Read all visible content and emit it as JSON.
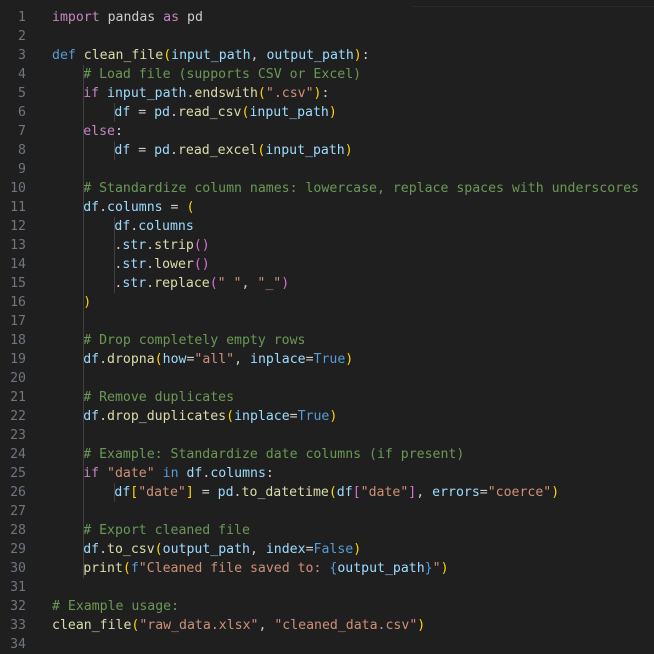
{
  "editor": {
    "line_numbers": [
      "1",
      "2",
      "3",
      "4",
      "5",
      "6",
      "7",
      "8",
      "9",
      "10",
      "11",
      "12",
      "13",
      "14",
      "15",
      "16",
      "17",
      "18",
      "19",
      "20",
      "21",
      "22",
      "23",
      "24",
      "25",
      "26",
      "27",
      "28",
      "29",
      "30",
      "31",
      "32",
      "33",
      "34"
    ],
    "lines": [
      [
        [
          "kw",
          "import"
        ],
        [
          "pun",
          " pandas "
        ],
        [
          "kw",
          "as"
        ],
        [
          "pun",
          " pd"
        ]
      ],
      [],
      [
        [
          "kwb",
          "def"
        ],
        [
          "pun",
          " "
        ],
        [
          "fn",
          "clean_file"
        ],
        [
          "p1",
          "("
        ],
        [
          "var",
          "input_path"
        ],
        [
          "pun",
          ", "
        ],
        [
          "var",
          "output_path"
        ],
        [
          "p1",
          ")"
        ],
        [
          "pun",
          ":"
        ]
      ],
      [
        [
          "com",
          "# Load file (supports CSV or Excel)"
        ]
      ],
      [
        [
          "kw",
          "if"
        ],
        [
          "pun",
          " "
        ],
        [
          "var",
          "input_path"
        ],
        [
          "pun",
          "."
        ],
        [
          "fn",
          "endswith"
        ],
        [
          "p1",
          "("
        ],
        [
          "str",
          "\".csv\""
        ],
        [
          "p1",
          ")"
        ],
        [
          "pun",
          ":"
        ]
      ],
      [
        [
          "var",
          "df"
        ],
        [
          "pun",
          " = "
        ],
        [
          "var",
          "pd"
        ],
        [
          "pun",
          "."
        ],
        [
          "fn",
          "read_csv"
        ],
        [
          "p1",
          "("
        ],
        [
          "var",
          "input_path"
        ],
        [
          "p1",
          ")"
        ]
      ],
      [
        [
          "kw",
          "else"
        ],
        [
          "pun",
          ":"
        ]
      ],
      [
        [
          "var",
          "df"
        ],
        [
          "pun",
          " = "
        ],
        [
          "var",
          "pd"
        ],
        [
          "pun",
          "."
        ],
        [
          "fn",
          "read_excel"
        ],
        [
          "p1",
          "("
        ],
        [
          "var",
          "input_path"
        ],
        [
          "p1",
          ")"
        ]
      ],
      [],
      [
        [
          "com",
          "# Standardize column names: lowercase, replace spaces with underscores"
        ]
      ],
      [
        [
          "var",
          "df"
        ],
        [
          "pun",
          "."
        ],
        [
          "var",
          "columns"
        ],
        [
          "pun",
          " = "
        ],
        [
          "p1",
          "("
        ]
      ],
      [
        [
          "var",
          "df"
        ],
        [
          "pun",
          "."
        ],
        [
          "var",
          "columns"
        ]
      ],
      [
        [
          "pun",
          "."
        ],
        [
          "var",
          "str"
        ],
        [
          "pun",
          "."
        ],
        [
          "fn",
          "strip"
        ],
        [
          "p2",
          "()"
        ]
      ],
      [
        [
          "pun",
          "."
        ],
        [
          "var",
          "str"
        ],
        [
          "pun",
          "."
        ],
        [
          "fn",
          "lower"
        ],
        [
          "p2",
          "()"
        ]
      ],
      [
        [
          "pun",
          "."
        ],
        [
          "var",
          "str"
        ],
        [
          "pun",
          "."
        ],
        [
          "fn",
          "replace"
        ],
        [
          "p2",
          "("
        ],
        [
          "str",
          "\" \""
        ],
        [
          "pun",
          ", "
        ],
        [
          "str",
          "\"_\""
        ],
        [
          "p2",
          ")"
        ]
      ],
      [
        [
          "p1",
          ")"
        ]
      ],
      [],
      [
        [
          "com",
          "# Drop completely empty rows"
        ]
      ],
      [
        [
          "var",
          "df"
        ],
        [
          "pun",
          "."
        ],
        [
          "fn",
          "dropna"
        ],
        [
          "p1",
          "("
        ],
        [
          "var",
          "how"
        ],
        [
          "pun",
          "="
        ],
        [
          "str",
          "\"all\""
        ],
        [
          "pun",
          ", "
        ],
        [
          "var",
          "inplace"
        ],
        [
          "pun",
          "="
        ],
        [
          "kwb",
          "True"
        ],
        [
          "p1",
          ")"
        ]
      ],
      [],
      [
        [
          "com",
          "# Remove duplicates"
        ]
      ],
      [
        [
          "var",
          "df"
        ],
        [
          "pun",
          "."
        ],
        [
          "fn",
          "drop_duplicates"
        ],
        [
          "p1",
          "("
        ],
        [
          "var",
          "inplace"
        ],
        [
          "pun",
          "="
        ],
        [
          "kwb",
          "True"
        ],
        [
          "p1",
          ")"
        ]
      ],
      [],
      [
        [
          "com",
          "# Example: Standardize date columns (if present)"
        ]
      ],
      [
        [
          "kw",
          "if"
        ],
        [
          "pun",
          " "
        ],
        [
          "str",
          "\"date\""
        ],
        [
          "pun",
          " "
        ],
        [
          "kwb",
          "in"
        ],
        [
          "pun",
          " "
        ],
        [
          "var",
          "df"
        ],
        [
          "pun",
          "."
        ],
        [
          "var",
          "columns"
        ],
        [
          "pun",
          ":"
        ]
      ],
      [
        [
          "var",
          "df"
        ],
        [
          "p1",
          "["
        ],
        [
          "str",
          "\"date\""
        ],
        [
          "p1",
          "]"
        ],
        [
          "pun",
          " = "
        ],
        [
          "var",
          "pd"
        ],
        [
          "pun",
          "."
        ],
        [
          "fn",
          "to_datetime"
        ],
        [
          "p1",
          "("
        ],
        [
          "var",
          "df"
        ],
        [
          "p2",
          "["
        ],
        [
          "str",
          "\"date\""
        ],
        [
          "p2",
          "]"
        ],
        [
          "pun",
          ", "
        ],
        [
          "var",
          "errors"
        ],
        [
          "pun",
          "="
        ],
        [
          "str",
          "\"coerce\""
        ],
        [
          "p1",
          ")"
        ]
      ],
      [],
      [
        [
          "com",
          "# Export cleaned file"
        ]
      ],
      [
        [
          "var",
          "df"
        ],
        [
          "pun",
          "."
        ],
        [
          "fn",
          "to_csv"
        ],
        [
          "p1",
          "("
        ],
        [
          "var",
          "output_path"
        ],
        [
          "pun",
          ", "
        ],
        [
          "var",
          "index"
        ],
        [
          "pun",
          "="
        ],
        [
          "kwb",
          "False"
        ],
        [
          "p1",
          ")"
        ]
      ],
      [
        [
          "fn",
          "print"
        ],
        [
          "p1",
          "("
        ],
        [
          "kwb",
          "f"
        ],
        [
          "str",
          "\"Cleaned file saved to: "
        ],
        [
          "kwb",
          "{"
        ],
        [
          "var",
          "output_path"
        ],
        [
          "kwb",
          "}"
        ],
        [
          "str",
          "\""
        ],
        [
          "p1",
          ")"
        ]
      ],
      [],
      [
        [
          "com",
          "# Example usage:"
        ]
      ],
      [
        [
          "fn",
          "clean_file"
        ],
        [
          "p1",
          "("
        ],
        [
          "str",
          "\"raw_data.xlsx\""
        ],
        [
          "pun",
          ", "
        ],
        [
          "str",
          "\"cleaned_data.csv\""
        ],
        [
          "p1",
          ")"
        ]
      ],
      []
    ]
  }
}
